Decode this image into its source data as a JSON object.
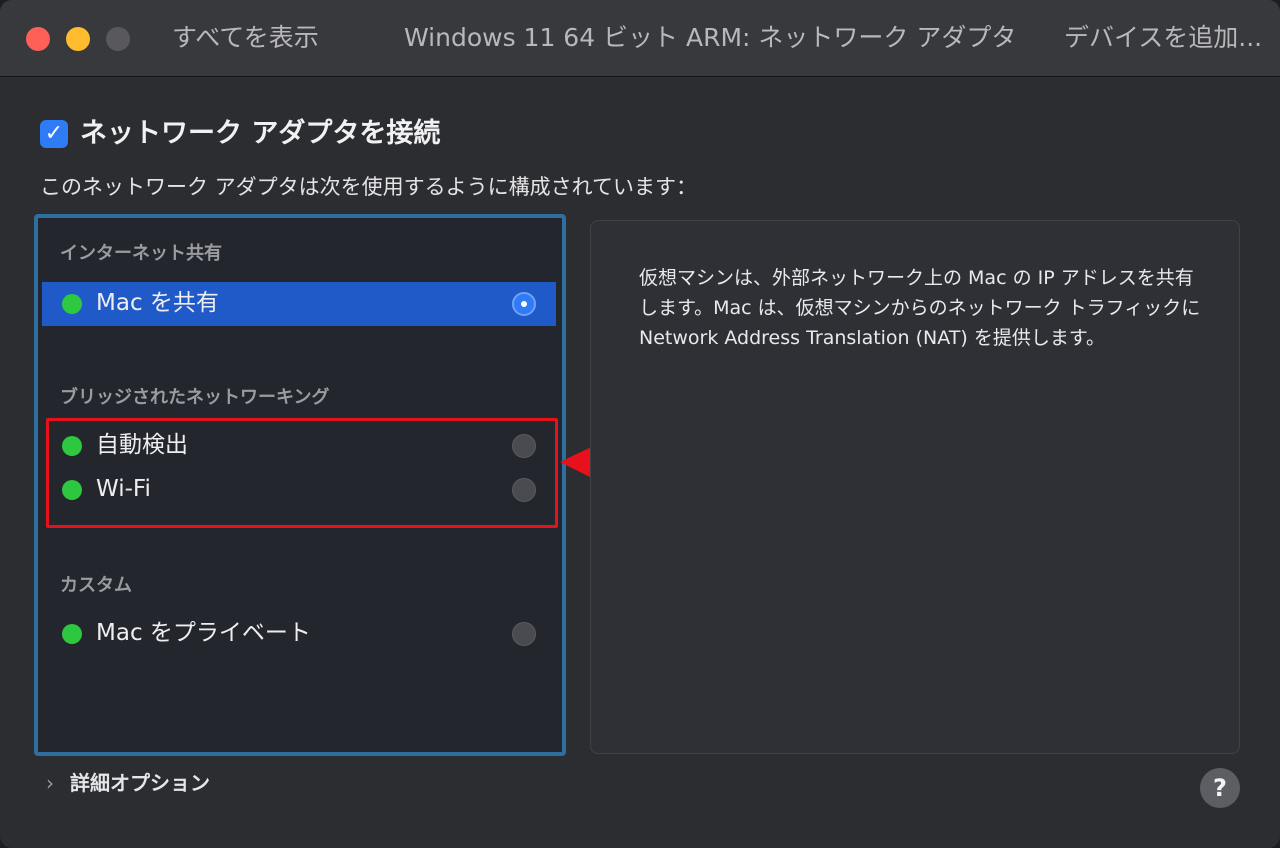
{
  "titlebar": {
    "show_all": "すべてを表示",
    "title": "Windows 11 64 ビット ARM: ネットワーク アダプタ",
    "add_device": "デバイスを追加..."
  },
  "connect_checkbox": {
    "label": "ネットワーク アダプタを接続",
    "checked": true
  },
  "subtitle": "このネットワーク アダプタは次を使用するように構成されています：",
  "sections": {
    "internet_sharing": {
      "header": "インターネット共有",
      "items": [
        {
          "label": "Mac を共有",
          "selected": true
        }
      ]
    },
    "bridged": {
      "header": "ブリッジされたネットワーキング",
      "items": [
        {
          "label": "自動検出",
          "selected": false
        },
        {
          "label": "Wi-Fi",
          "selected": false
        }
      ]
    },
    "custom": {
      "header": "カスタム",
      "items": [
        {
          "label": "Mac をプライベート",
          "selected": false
        }
      ]
    }
  },
  "description": "仮想マシンは、外部ネットワーク上の Mac の IP アドレスを共有します。Mac は、仮想マシンからのネットワーク トラフィックに Network Address Translation (NAT) を提供します。",
  "advanced_options": "詳細オプション",
  "help": "?",
  "colors": {
    "accent": "#2f7bf5",
    "selection": "#1f5ac8",
    "status_green": "#2dc840",
    "annotation_red": "#e8101a"
  }
}
